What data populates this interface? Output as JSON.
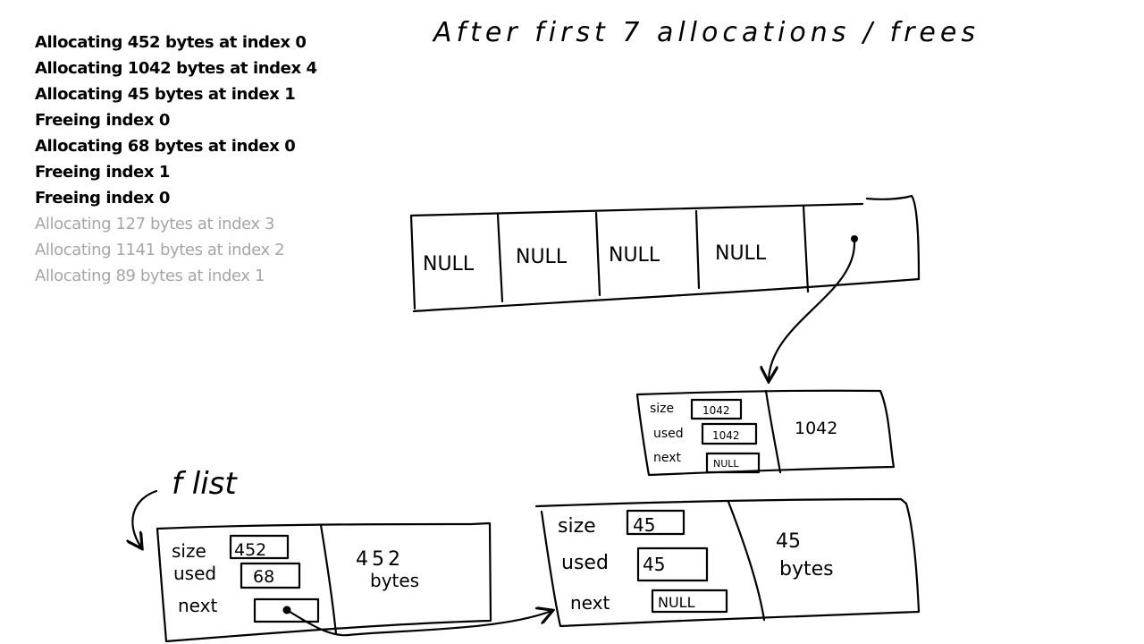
{
  "title": "After first 7 allocations / frees",
  "log": [
    {
      "text": "Allocating 452 bytes at index 0",
      "state": "done"
    },
    {
      "text": "Allocating 1042 bytes at index 4",
      "state": "done"
    },
    {
      "text": "Allocating 45 bytes at index 1",
      "state": "done"
    },
    {
      "text": "Freeing index 0",
      "state": "done"
    },
    {
      "text": "Allocating 68 bytes at index 0",
      "state": "done"
    },
    {
      "text": "Freeing index 1",
      "state": "done"
    },
    {
      "text": "Freeing index 0",
      "state": "done"
    },
    {
      "text": "Allocating 127 bytes at index 3",
      "state": "pending"
    },
    {
      "text": "Allocating 1141 bytes at index 2",
      "state": "pending"
    },
    {
      "text": "Allocating 89 bytes at index 1",
      "state": "pending"
    }
  ],
  "array": {
    "cells": [
      "NULL",
      "NULL",
      "NULL",
      "NULL",
      "•"
    ]
  },
  "flist_label": "f list",
  "blocks": {
    "b1042": {
      "size_label": "size",
      "size": "1042",
      "used_label": "used",
      "used": "1042",
      "next_label": "next",
      "next": "NULL",
      "payload": "1042"
    },
    "b452": {
      "size_label": "size",
      "size": "452",
      "used_label": "used",
      "used": "68",
      "next_label": "next",
      "next": "•",
      "payload_line1": "452",
      "payload_line2": "bytes"
    },
    "b45": {
      "size_label": "size",
      "size": "45",
      "used_label": "used",
      "used": "45",
      "next_label": "next",
      "next": "NULL",
      "payload_line1": "45",
      "payload_line2": "bytes"
    }
  },
  "colors": {
    "ink": "#000000",
    "pending": "#a6a6a6"
  }
}
